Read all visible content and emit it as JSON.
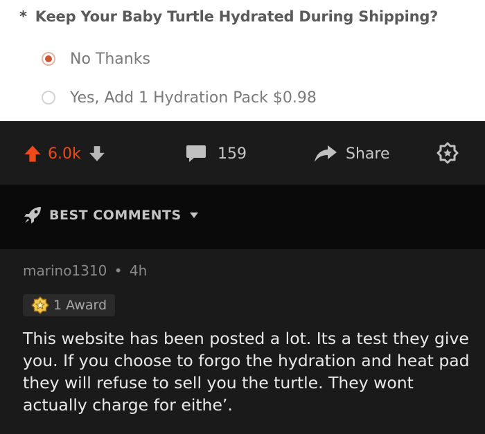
{
  "form": {
    "required_mark": "*",
    "question": "Keep Your Baby Turtle Hydrated During Shipping?",
    "options": [
      {
        "label": "No Thanks",
        "selected": true
      },
      {
        "label": "Yes, Add 1 Hydration Pack $0.98",
        "selected": false
      }
    ]
  },
  "post_bar": {
    "score": "6.0k",
    "comment_count": "159",
    "share_label": "Share",
    "colors": {
      "upvote": "#f04a1a",
      "text": "#c8c8c8"
    },
    "icons": [
      "upvote-arrow-icon",
      "downvote-arrow-icon",
      "comment-icon",
      "share-icon",
      "award-icon"
    ]
  },
  "comments": {
    "sort_label": "BEST COMMENTS",
    "sort_icon": "rocket-icon",
    "items": [
      {
        "author": "marino1310",
        "separator": "•",
        "age": "4h",
        "award_label": "1 Award",
        "body": "This website has been posted a lot. Its a test they give you. If you choose to forgo the hydration and heat pad they will refuse to sell you the turtle. They wont actually charge for eithe’."
      }
    ]
  }
}
